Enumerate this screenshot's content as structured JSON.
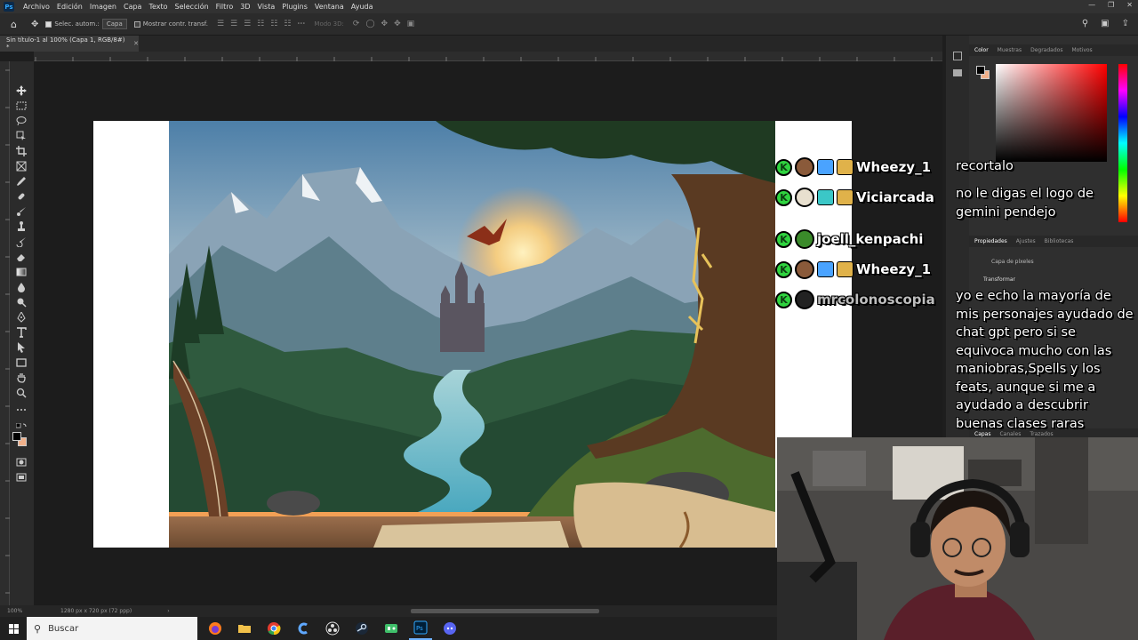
{
  "app": {
    "logo_text": "Ps",
    "menu": [
      "Archivo",
      "Edición",
      "Imagen",
      "Capa",
      "Texto",
      "Selección",
      "Filtro",
      "3D",
      "Vista",
      "Plugins",
      "Ventana",
      "Ayuda"
    ]
  },
  "options_bar": {
    "auto_select_label": "Selec. autom.:",
    "auto_select_value": "Capa",
    "transform_controls_label": "Mostrar contr. transf.",
    "mode_3d_label": "Modo 3D:"
  },
  "document": {
    "tab_title": "Sin título-1 al 100% (Capa 1, RGB/8#) *",
    "zoom": "100%",
    "doc_info": "1280 px x 720 px (72 ppp)"
  },
  "panels": {
    "color_tabs": [
      "Color",
      "Muestras",
      "Degradados",
      "Motivos"
    ],
    "properties_tabs": [
      "Propiedades",
      "Ajustes",
      "Bibliotecas"
    ],
    "pixel_layer_label": "Capa de píxeles",
    "transform_label": "Transformar",
    "layers_tabs": [
      "Capas",
      "Canales",
      "Trazados"
    ],
    "colors": {
      "accent": "#31a8ff",
      "panel_bg": "#2f2f2f"
    }
  },
  "chat": {
    "users": [
      {
        "name": "Wheezy_1",
        "avatar_color": "#8a5a3a",
        "badge_color": "#4aa3ff"
      },
      {
        "name": "Viciarcada",
        "avatar_color": "#e8e0cf",
        "badge_color": "#3bc7c7"
      },
      {
        "name": "joell_kenpachi",
        "avatar_color": "#3a8a2a",
        "badge_color": ""
      },
      {
        "name": "Wheezy_1",
        "avatar_color": "#8a5a3a",
        "badge_color": "#4aa3ff"
      },
      {
        "name": "mrcolonoscopia",
        "avatar_color": "#222222",
        "badge_color": ""
      }
    ],
    "messages": [
      "recortalo",
      "no le digas el logo de gemini pendejo",
      "yo e echo la mayoría de mis personajes ayudado de chat gpt pero si se equivoca mucho con las maniobras,Spells y los feats, aunque si me a ayudado a descubrir buenas clases raras"
    ],
    "badge_letter": "K"
  },
  "taskbar": {
    "search_placeholder": "Buscar"
  }
}
